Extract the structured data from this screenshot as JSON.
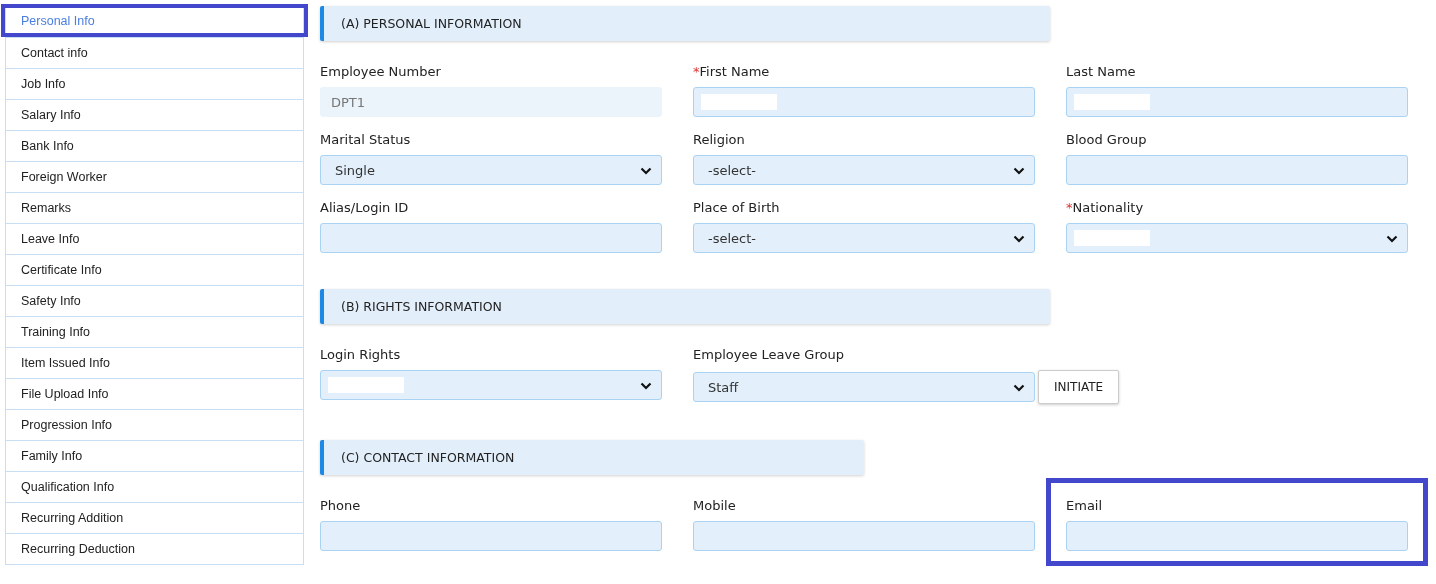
{
  "sidebar": {
    "items": [
      {
        "label": "Personal Info",
        "selected": true,
        "highlighted": true
      },
      {
        "label": "Contact info",
        "selected": false,
        "highlighted": false
      },
      {
        "label": "Job Info",
        "selected": false,
        "highlighted": false
      },
      {
        "label": "Salary Info",
        "selected": false,
        "highlighted": false
      },
      {
        "label": "Bank Info",
        "selected": false,
        "highlighted": false
      },
      {
        "label": "Foreign Worker",
        "selected": false,
        "highlighted": false
      },
      {
        "label": "Remarks",
        "selected": false,
        "highlighted": false
      },
      {
        "label": "Leave Info",
        "selected": false,
        "highlighted": false
      },
      {
        "label": "Certificate Info",
        "selected": false,
        "highlighted": false
      },
      {
        "label": "Safety Info",
        "selected": false,
        "highlighted": false
      },
      {
        "label": "Training Info",
        "selected": false,
        "highlighted": false
      },
      {
        "label": "Item Issued Info",
        "selected": false,
        "highlighted": false
      },
      {
        "label": "File Upload Info",
        "selected": false,
        "highlighted": false
      },
      {
        "label": "Progression Info",
        "selected": false,
        "highlighted": false
      },
      {
        "label": "Family Info",
        "selected": false,
        "highlighted": false
      },
      {
        "label": "Qualification Info",
        "selected": false,
        "highlighted": false
      },
      {
        "label": "Recurring Addition",
        "selected": false,
        "highlighted": false
      },
      {
        "label": "Recurring Deduction",
        "selected": false,
        "highlighted": false
      }
    ]
  },
  "sections": [
    {
      "title": "(A) PERSONAL INFORMATION",
      "kind": "wide",
      "fields": [
        {
          "label": "Employee Number",
          "kind": "readonly",
          "value": "DPT1",
          "redacted": false,
          "highlighted": false
        },
        {
          "required_mark": "*",
          "label": "First Name",
          "kind": "input",
          "redacted": true,
          "highlighted": false
        },
        {
          "label": "Last Name",
          "kind": "input",
          "redacted": true,
          "highlighted": false
        },
        {
          "label": "Marital Status",
          "kind": "select",
          "value": "Single",
          "redacted": false,
          "highlighted": false
        },
        {
          "label": "Religion",
          "kind": "select",
          "value": "-select-",
          "redacted": false,
          "highlighted": false
        },
        {
          "label": "Blood Group",
          "kind": "input",
          "redacted": false,
          "highlighted": false
        },
        {
          "label": "Alias/Login ID",
          "kind": "input",
          "redacted": false,
          "highlighted": false
        },
        {
          "label": "Place of Birth",
          "kind": "select",
          "value": "-select-",
          "redacted": false,
          "highlighted": false
        },
        {
          "required_mark": "*",
          "label": "Nationality",
          "kind": "select",
          "redacted": true,
          "highlighted": false
        }
      ]
    },
    {
      "title": "(B) RIGHTS INFORMATION",
      "kind": "wide",
      "fields": [
        {
          "label": "Login Rights",
          "kind": "select",
          "redacted": true,
          "highlighted": false
        },
        {
          "label": "Employee Leave Group",
          "kind": "select",
          "value": "Staff",
          "redacted": false,
          "highlighted": false,
          "button": "INITIATE"
        }
      ]
    },
    {
      "title": "(C) CONTACT INFORMATION",
      "kind": "narrow",
      "fields": [
        {
          "label": "Phone",
          "kind": "input",
          "redacted": false,
          "highlighted": false
        },
        {
          "label": "Mobile",
          "kind": "input",
          "redacted": false,
          "highlighted": false
        },
        {
          "label": "Email",
          "kind": "input",
          "redacted": false,
          "highlighted": true
        }
      ]
    }
  ]
}
